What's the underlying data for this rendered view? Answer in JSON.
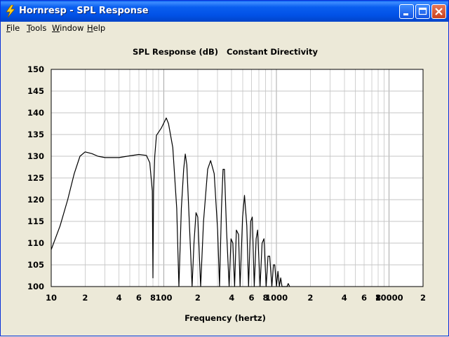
{
  "window": {
    "title": "Hornresp - SPL Response",
    "colors": {
      "titlebar": "#0a5ff0",
      "close": "#c8411e",
      "background": "#ece9d8"
    }
  },
  "menu": {
    "items": [
      "File",
      "Tools",
      "Window",
      "Help"
    ]
  },
  "chart_data": {
    "type": "line",
    "title": "SPL Response (dB)   Constant Directivity",
    "xlabel": "Frequency (hertz)",
    "ylabel": "",
    "x_scale": "log",
    "xlim": [
      10,
      20000
    ],
    "ylim": [
      100,
      150
    ],
    "grid": true,
    "x_tick_labels": [
      {
        "v": 10,
        "t": "10"
      },
      {
        "v": 20,
        "t": "2"
      },
      {
        "v": 40,
        "t": "4"
      },
      {
        "v": 60,
        "t": "6"
      },
      {
        "v": 80,
        "t": "8"
      },
      {
        "v": 100,
        "t": "100"
      },
      {
        "v": 200,
        "t": "2"
      },
      {
        "v": 400,
        "t": "4"
      },
      {
        "v": 600,
        "t": "6"
      },
      {
        "v": 800,
        "t": "8"
      },
      {
        "v": 1000,
        "t": "1000"
      },
      {
        "v": 2000,
        "t": "2"
      },
      {
        "v": 4000,
        "t": "4"
      },
      {
        "v": 6000,
        "t": "6"
      },
      {
        "v": 8000,
        "t": "8"
      },
      {
        "v": 10000,
        "t": "10000"
      },
      {
        "v": 20000,
        "t": "2"
      }
    ],
    "y_ticks": [
      100,
      105,
      110,
      115,
      120,
      125,
      130,
      135,
      140,
      145,
      150
    ],
    "series": [
      {
        "color": "#000000",
        "points": [
          [
            10,
            108.5
          ],
          [
            12,
            114
          ],
          [
            14,
            120
          ],
          [
            16,
            126
          ],
          [
            18,
            130
          ],
          [
            20,
            131
          ],
          [
            23,
            130.6
          ],
          [
            26,
            130
          ],
          [
            30,
            129.7
          ],
          [
            40,
            129.7
          ],
          [
            50,
            130.1
          ],
          [
            60,
            130.4
          ],
          [
            70,
            130.2
          ],
          [
            75,
            128.5
          ],
          [
            79,
            122
          ],
          [
            80,
            102
          ],
          [
            81,
            122
          ],
          [
            83,
            130
          ],
          [
            86,
            134.8
          ],
          [
            95,
            136.5
          ],
          [
            105,
            138.8
          ],
          [
            110,
            137.5
          ],
          [
            120,
            132
          ],
          [
            130,
            118
          ],
          [
            136,
            100
          ],
          [
            143,
            118
          ],
          [
            150,
            127
          ],
          [
            155,
            130.5
          ],
          [
            160,
            128
          ],
          [
            170,
            112
          ],
          [
            178,
            100
          ],
          [
            185,
            110
          ],
          [
            193,
            117
          ],
          [
            200,
            116
          ],
          [
            212,
            100
          ],
          [
            225,
            115
          ],
          [
            245,
            127
          ],
          [
            260,
            129
          ],
          [
            280,
            126
          ],
          [
            300,
            113
          ],
          [
            312,
            100
          ],
          [
            325,
            118
          ],
          [
            335,
            127
          ],
          [
            345,
            127
          ],
          [
            360,
            113
          ],
          [
            380,
            100
          ],
          [
            395,
            111
          ],
          [
            410,
            110
          ],
          [
            425,
            100
          ],
          [
            440,
            113
          ],
          [
            460,
            112
          ],
          [
            475,
            100
          ],
          [
            500,
            116
          ],
          [
            520,
            121
          ],
          [
            545,
            114
          ],
          [
            565,
            100
          ],
          [
            590,
            115
          ],
          [
            610,
            116
          ],
          [
            635,
            100
          ],
          [
            660,
            111
          ],
          [
            680,
            113
          ],
          [
            715,
            100
          ],
          [
            745,
            110
          ],
          [
            775,
            111
          ],
          [
            810,
            100
          ],
          [
            840,
            107
          ],
          [
            870,
            107
          ],
          [
            910,
            100
          ],
          [
            940,
            105
          ],
          [
            965,
            105
          ],
          [
            1000,
            100
          ],
          [
            1030,
            103.5
          ],
          [
            1060,
            100
          ],
          [
            1090,
            102
          ],
          [
            1120,
            100
          ],
          [
            1240,
            100
          ],
          [
            1270,
            100.7
          ],
          [
            1310,
            100
          ]
        ]
      }
    ]
  }
}
